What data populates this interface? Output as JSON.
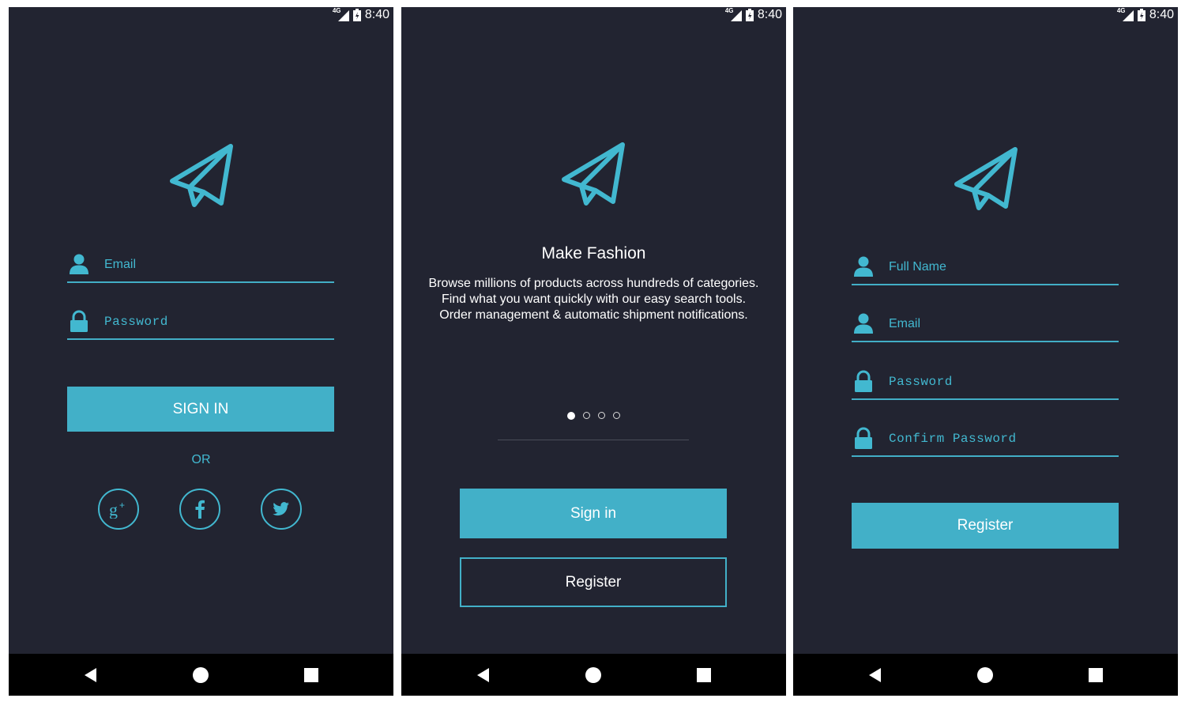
{
  "status": {
    "network": "4G",
    "time": "8:40"
  },
  "screen_login": {
    "email_placeholder": "Email",
    "password_placeholder": "Password",
    "signin_label": "SIGN IN",
    "or_label": "OR",
    "social": [
      "google-plus",
      "facebook",
      "twitter"
    ]
  },
  "screen_intro": {
    "title": "Make Fashion",
    "description": "Browse millions of products across hundreds of categories. Find what you want quickly with our easy search tools. Order management & automatic shipment notifications.",
    "page_indicator": {
      "current": 1,
      "total": 4
    },
    "signin_label": "Sign in",
    "register_label": "Register"
  },
  "screen_register": {
    "fullname_placeholder": "Full Name",
    "email_placeholder": "Email",
    "password_placeholder": "Password",
    "confirm_placeholder": "Confirm Password",
    "register_label": "Register"
  },
  "colors": {
    "background": "#222431",
    "accent": "#42b0c8",
    "navbar": "#000000"
  }
}
